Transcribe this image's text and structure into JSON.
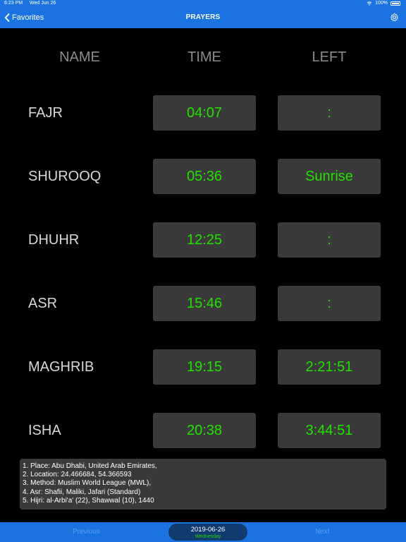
{
  "status": {
    "time": "6:23 PM",
    "date": "Wed Jun 26",
    "battery": "100%"
  },
  "nav": {
    "back_label": "Favorites",
    "title": "PRAYERS",
    "settings_icon": "gear-icon"
  },
  "columns": {
    "name": "NAME",
    "time": "TIME",
    "left": "LEFT"
  },
  "prayers": [
    {
      "name": "FAJR",
      "time": "04:07",
      "left": ":"
    },
    {
      "name": "SHUROOQ",
      "time": "05:36",
      "left": "Sunrise"
    },
    {
      "name": "DHUHR",
      "time": "12:25",
      "left": ":"
    },
    {
      "name": "ASR",
      "time": "15:46",
      "left": ":"
    },
    {
      "name": "MAGHRIB",
      "time": "19:15",
      "left": "2:21:51"
    },
    {
      "name": "ISHA",
      "time": "20:38",
      "left": "3:44:51"
    }
  ],
  "info": [
    "1. Place: Abu Dhabi, United Arab Emirates,",
    "2. Location: 24.466684, 54.366593",
    "3. Method: Muslim World League (MWL),",
    "4. Asr: Shafii, Maliki, Jafari (Standard)",
    "5. Hijri: al-Arbi'a' (22), Shawwal (10), 1440"
  ],
  "bottom": {
    "previous_label": "Previous",
    "next_label": "Next",
    "date": "2019-06-26",
    "weekday": "Wednesday"
  },
  "colors": {
    "bar_blue": "#1a73e0",
    "value_green": "#22e000",
    "cell_gray": "#3a3a3a"
  }
}
